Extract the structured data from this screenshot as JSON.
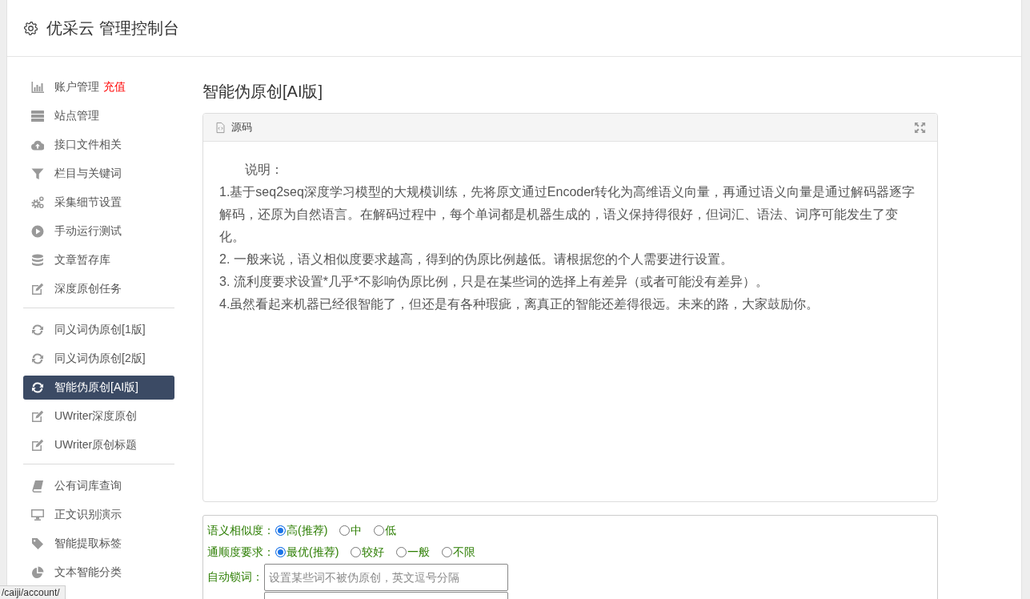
{
  "header": {
    "title": "优采云 管理控制台"
  },
  "sidebar": {
    "groups": [
      {
        "items": [
          {
            "label": "账户管理",
            "link": "充值",
            "selected": false
          },
          {
            "label": "站点管理",
            "selected": false
          },
          {
            "label": "接口文件相关",
            "selected": false
          },
          {
            "label": "栏目与关键词",
            "selected": false
          },
          {
            "label": "采集细节设置",
            "selected": false
          },
          {
            "label": "手动运行测试",
            "selected": false
          },
          {
            "label": "文章暂存库",
            "selected": false
          },
          {
            "label": "深度原创任务",
            "selected": false
          }
        ]
      },
      {
        "items": [
          {
            "label": "同义词伪原创[1版]",
            "selected": false
          },
          {
            "label": "同义词伪原创[2版]",
            "selected": false
          },
          {
            "label": "智能伪原创[AI版]",
            "selected": true
          },
          {
            "label": "UWriter深度原创",
            "selected": false
          },
          {
            "label": "UWriter原创标题",
            "selected": false
          }
        ]
      },
      {
        "items": [
          {
            "label": "公有词库查询",
            "selected": false
          },
          {
            "label": "正文识别演示",
            "selected": false
          },
          {
            "label": "智能提取标签",
            "selected": false
          },
          {
            "label": "文本智能分类",
            "selected": false
          }
        ]
      }
    ]
  },
  "main": {
    "title": "智能伪原创[AI版]",
    "source_panel": {
      "title": "源码",
      "heading": "说明：",
      "paragraphs": [
        "1.基于seq2seq深度学习模型的大规模训练，先将原文通过Encoder转化为高维语义向量，再通过语义向量是通过解码器逐字解码，还原为自然语言。在解码过程中，每个单词都是机器生成的，语义保持得很好，但词汇、语法、词序可能发生了变化。",
        "2. 一般来说，语义相似度要求越高，得到的伪原比例越低。请根据您的个人需要进行设置。",
        "3. 流利度要求设置*几乎*不影响伪原比例，只是在某些词的选择上有差异（或者可能没有差异）。",
        "4.虽然看起来机器已经很智能了，但还是有各种瑕疵，离真正的智能还差得很远。未来的路，大家鼓励你。"
      ]
    },
    "options_form": {
      "rows": [
        {
          "kind": "radio",
          "label": "语义相似度：",
          "options": [
            {
              "label": "高(推荐)",
              "selected": true
            },
            {
              "label": "中",
              "selected": false
            },
            {
              "label": "低",
              "selected": false
            }
          ]
        },
        {
          "kind": "radio",
          "label": "通顺度要求：",
          "options": [
            {
              "label": "最优(推荐)",
              "selected": true
            },
            {
              "label": "较好",
              "selected": false
            },
            {
              "label": "一般",
              "selected": false
            },
            {
              "label": "不限",
              "selected": false
            }
          ]
        },
        {
          "kind": "text",
          "label": "自动锁词：",
          "placeholder": "设置某些词不被伪原创，英文逗号分隔"
        },
        {
          "kind": "text"
        }
      ]
    }
  },
  "status_bar": {
    "url": "/caiji/account/"
  }
}
